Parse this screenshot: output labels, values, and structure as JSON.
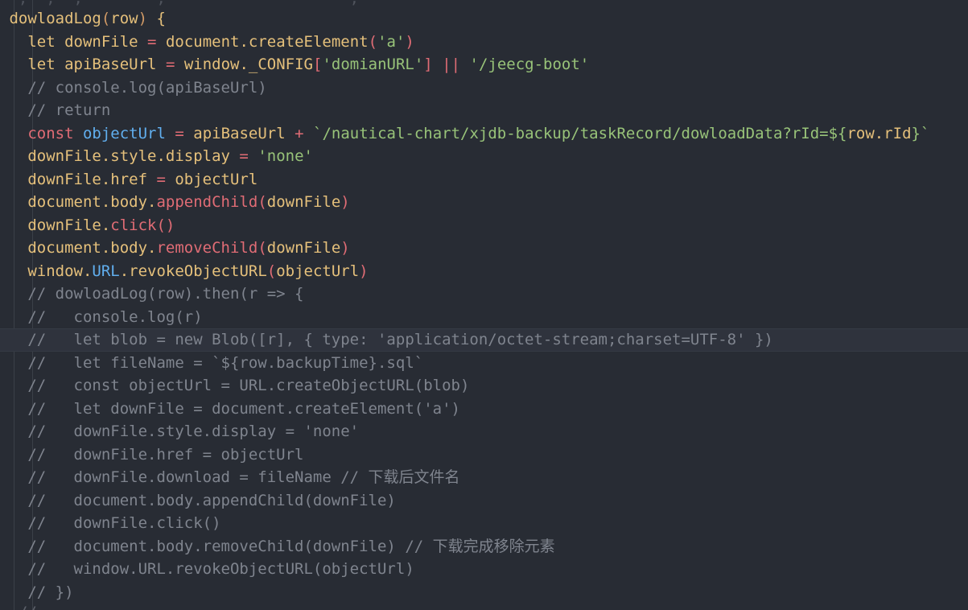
{
  "editor": {
    "colors": {
      "background": "#282c34",
      "current_line": "#2f333d",
      "indent_guide": "#3b4048",
      "default": "#abb2bf",
      "keyword": "#e06c75",
      "variable": "#e5c07b",
      "function": "#61afef",
      "string": "#98c379",
      "comment": "#7f848e",
      "bracket_gold": "#d19a66",
      "bracket_pink": "#c678dd"
    },
    "current_line_index": 14,
    "top_partial_line": [
      {
        "t": "  ,  ,  ,        ,                    ,",
        "c": "comment"
      }
    ],
    "bottom_partial_line": [
      {
        "t": "  //  ",
        "c": "comment"
      }
    ],
    "lines": [
      [
        {
          "t": " dowloadLog",
          "c": "variable"
        },
        {
          "t": "(",
          "c": "bracket_gold"
        },
        {
          "t": "row",
          "c": "variable"
        },
        {
          "t": ")",
          "c": "bracket_gold"
        },
        {
          "t": " {",
          "c": "variable"
        }
      ],
      [
        {
          "t": "   ",
          "c": "default"
        },
        {
          "t": "let",
          "c": "variable"
        },
        {
          "t": " downFile ",
          "c": "variable"
        },
        {
          "t": "=",
          "c": "keyword"
        },
        {
          "t": " document.",
          "c": "variable"
        },
        {
          "t": "createElement",
          "c": "variable"
        },
        {
          "t": "(",
          "c": "keyword"
        },
        {
          "t": "'a'",
          "c": "string"
        },
        {
          "t": ")",
          "c": "keyword"
        }
      ],
      [
        {
          "t": "   ",
          "c": "default"
        },
        {
          "t": "let",
          "c": "variable"
        },
        {
          "t": " apiBaseUrl ",
          "c": "variable"
        },
        {
          "t": "=",
          "c": "keyword"
        },
        {
          "t": " window._CONFIG",
          "c": "variable"
        },
        {
          "t": "[",
          "c": "keyword"
        },
        {
          "t": "'domianURL'",
          "c": "string"
        },
        {
          "t": "]",
          "c": "keyword"
        },
        {
          "t": " ",
          "c": "default"
        },
        {
          "t": "||",
          "c": "keyword"
        },
        {
          "t": " ",
          "c": "default"
        },
        {
          "t": "'/jeecg-boot'",
          "c": "string"
        }
      ],
      [
        {
          "t": "   // console.log(apiBaseUrl)",
          "c": "comment"
        }
      ],
      [
        {
          "t": "   // return",
          "c": "comment"
        }
      ],
      [
        {
          "t": "   ",
          "c": "default"
        },
        {
          "t": "const",
          "c": "keyword"
        },
        {
          "t": " objectUrl ",
          "c": "function"
        },
        {
          "t": "=",
          "c": "keyword"
        },
        {
          "t": " apiBaseUrl ",
          "c": "variable"
        },
        {
          "t": "+",
          "c": "keyword"
        },
        {
          "t": " `/nautical-chart/xjdb-backup/taskRecord/dowloadData?rId=${",
          "c": "string"
        },
        {
          "t": "row.rId",
          "c": "variable"
        },
        {
          "t": "}`",
          "c": "string"
        }
      ],
      [
        {
          "t": "   downFile.style.display ",
          "c": "variable"
        },
        {
          "t": "=",
          "c": "keyword"
        },
        {
          "t": " ",
          "c": "default"
        },
        {
          "t": "'none'",
          "c": "string"
        }
      ],
      [
        {
          "t": "   downFile.href ",
          "c": "variable"
        },
        {
          "t": "=",
          "c": "keyword"
        },
        {
          "t": " objectUrl",
          "c": "variable"
        }
      ],
      [
        {
          "t": "   document.body.",
          "c": "variable"
        },
        {
          "t": "appendChild",
          "c": "keyword"
        },
        {
          "t": "(",
          "c": "keyword"
        },
        {
          "t": "downFile",
          "c": "variable"
        },
        {
          "t": ")",
          "c": "keyword"
        }
      ],
      [
        {
          "t": "   downFile.",
          "c": "variable"
        },
        {
          "t": "click",
          "c": "keyword"
        },
        {
          "t": "()",
          "c": "keyword"
        }
      ],
      [
        {
          "t": "   document.body.",
          "c": "variable"
        },
        {
          "t": "removeChild",
          "c": "keyword"
        },
        {
          "t": "(",
          "c": "keyword"
        },
        {
          "t": "downFile",
          "c": "variable"
        },
        {
          "t": ")",
          "c": "keyword"
        }
      ],
      [
        {
          "t": "   window.",
          "c": "variable"
        },
        {
          "t": "URL",
          "c": "function"
        },
        {
          "t": ".",
          "c": "variable"
        },
        {
          "t": "revokeObjectURL",
          "c": "variable"
        },
        {
          "t": "(",
          "c": "keyword"
        },
        {
          "t": "objectUrl",
          "c": "variable"
        },
        {
          "t": ")",
          "c": "keyword"
        }
      ],
      [
        {
          "t": "   // dowloadLog(row).then(r => {",
          "c": "comment"
        }
      ],
      [
        {
          "t": "   //   console.log(r)",
          "c": "comment"
        }
      ],
      [
        {
          "t": "   //   let blob = new Blob([r], { type: 'application/octet-stream;charset=UTF-8' })",
          "c": "comment"
        }
      ],
      [
        {
          "t": "   //   let fileName = `${row.backupTime}.sql`",
          "c": "comment"
        }
      ],
      [
        {
          "t": "   //   const objectUrl = URL.createObjectURL(blob)",
          "c": "comment"
        }
      ],
      [
        {
          "t": "   //   let downFile = document.createElement('a')",
          "c": "comment"
        }
      ],
      [
        {
          "t": "   //   downFile.style.display = 'none'",
          "c": "comment"
        }
      ],
      [
        {
          "t": "   //   downFile.href = objectUrl",
          "c": "comment"
        }
      ],
      [
        {
          "t": "   //   downFile.download = fileName // 下载后文件名",
          "c": "comment"
        }
      ],
      [
        {
          "t": "   //   document.body.appendChild(downFile)",
          "c": "comment"
        }
      ],
      [
        {
          "t": "   //   downFile.click()",
          "c": "comment"
        }
      ],
      [
        {
          "t": "   //   document.body.removeChild(downFile) // 下载完成移除元素",
          "c": "comment"
        }
      ],
      [
        {
          "t": "   //   window.URL.revokeObjectURL(objectUrl)",
          "c": "comment"
        }
      ],
      [
        {
          "t": "   // })",
          "c": "comment"
        }
      ]
    ]
  }
}
